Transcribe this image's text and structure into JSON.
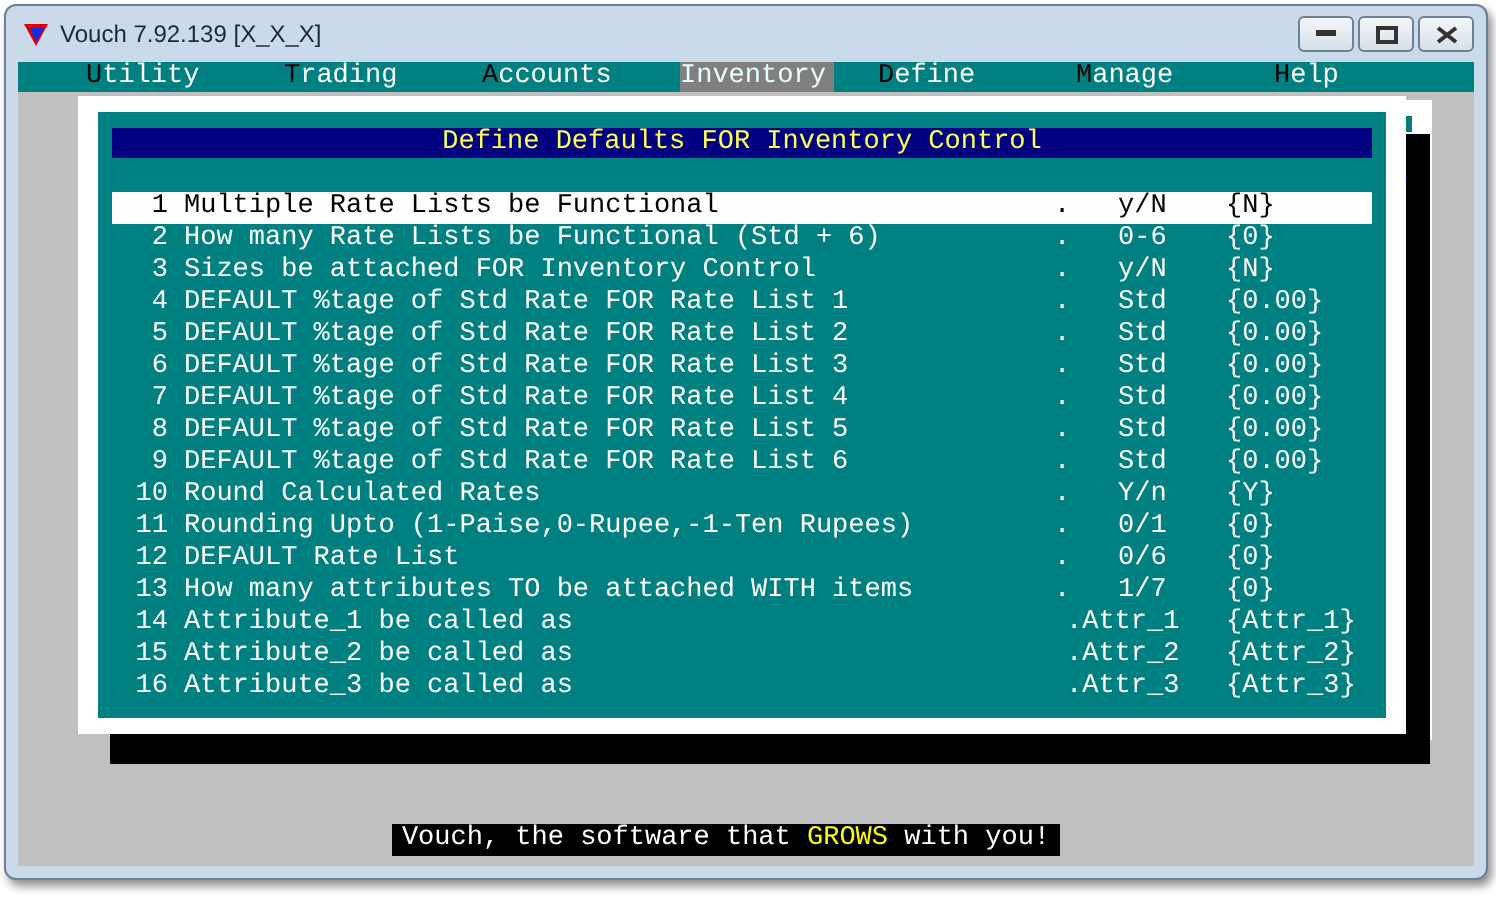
{
  "window": {
    "title": "Vouch  7.92.139  [X_X_X]"
  },
  "menu": [
    {
      "label": "Utility",
      "selected": false
    },
    {
      "label": "Trading",
      "selected": false
    },
    {
      "label": "Accounts",
      "selected": false
    },
    {
      "label": "Inventory",
      "selected": true
    },
    {
      "label": "Define",
      "selected": false
    },
    {
      "label": "Manage",
      "selected": false
    },
    {
      "label": "Help",
      "selected": false
    }
  ],
  "dialog": {
    "title": "Define Defaults FOR Inventory Control",
    "rows": [
      {
        "kind": "option",
        "number": "1",
        "label": "Multiple Rate Lists be Functional",
        "dot": ".",
        "hint": "y/N",
        "value": "{N}",
        "selected": true
      },
      {
        "kind": "option",
        "number": "2",
        "label": "How many Rate Lists be Functional (Std + 6)",
        "dot": ".",
        "hint": "0-6",
        "value": "{0}",
        "selected": false
      },
      {
        "kind": "option",
        "number": "3",
        "label": "Sizes be attached FOR Inventory Control",
        "dot": ".",
        "hint": "y/N",
        "value": "{N}",
        "selected": false
      },
      {
        "kind": "option",
        "number": "4",
        "label": "DEFAULT %tage of Std Rate FOR Rate List 1",
        "dot": ".",
        "hint": "Std",
        "value": "{0.00}",
        "selected": false
      },
      {
        "kind": "option",
        "number": "5",
        "label": "DEFAULT %tage of Std Rate FOR Rate List 2",
        "dot": ".",
        "hint": "Std",
        "value": "{0.00}",
        "selected": false
      },
      {
        "kind": "option",
        "number": "6",
        "label": "DEFAULT %tage of Std Rate FOR Rate List 3",
        "dot": ".",
        "hint": "Std",
        "value": "{0.00}",
        "selected": false
      },
      {
        "kind": "option",
        "number": "7",
        "label": "DEFAULT %tage of Std Rate FOR Rate List 4",
        "dot": ".",
        "hint": "Std",
        "value": "{0.00}",
        "selected": false
      },
      {
        "kind": "option",
        "number": "8",
        "label": "DEFAULT %tage of Std Rate FOR Rate List 5",
        "dot": ".",
        "hint": "Std",
        "value": "{0.00}",
        "selected": false
      },
      {
        "kind": "option",
        "number": "9",
        "label": "DEFAULT %tage of Std Rate FOR Rate List 6",
        "dot": ".",
        "hint": "Std",
        "value": "{0.00}",
        "selected": false
      },
      {
        "kind": "option",
        "number": "10",
        "label": "Round Calculated Rates",
        "dot": ".",
        "hint": "Y/n",
        "value": "{Y}",
        "selected": false
      },
      {
        "kind": "option",
        "number": "11",
        "label": "Rounding Upto (1-Paise,0-Rupee,-1-Ten Rupees)",
        "dot": ".",
        "hint": "0/1",
        "value": "{0}",
        "selected": false
      },
      {
        "kind": "option",
        "number": "12",
        "label": "DEFAULT Rate List",
        "dot": ".",
        "hint": "0/6",
        "value": "{0}",
        "selected": false
      },
      {
        "kind": "option",
        "number": "13",
        "label": "How many attributes TO be attached WITH items",
        "dot": ".",
        "hint": "1/7",
        "value": "{0}",
        "selected": false
      },
      {
        "kind": "attr",
        "number": "14",
        "label": "Attribute_1 be called as",
        "dot": ".",
        "hint": "Attr_1",
        "value": "{Attr_1}",
        "selected": false
      },
      {
        "kind": "attr",
        "number": "15",
        "label": "Attribute_2 be called as",
        "dot": ".",
        "hint": "Attr_2",
        "value": "{Attr_2}",
        "selected": false
      },
      {
        "kind": "attr",
        "number": "16",
        "label": "Attribute_3 be called as",
        "dot": ".",
        "hint": "Attr_3",
        "value": "{Attr_3}",
        "selected": false
      }
    ]
  },
  "status_bar": {
    "text": "Vouch, the software that **GROWS** with you!"
  }
}
